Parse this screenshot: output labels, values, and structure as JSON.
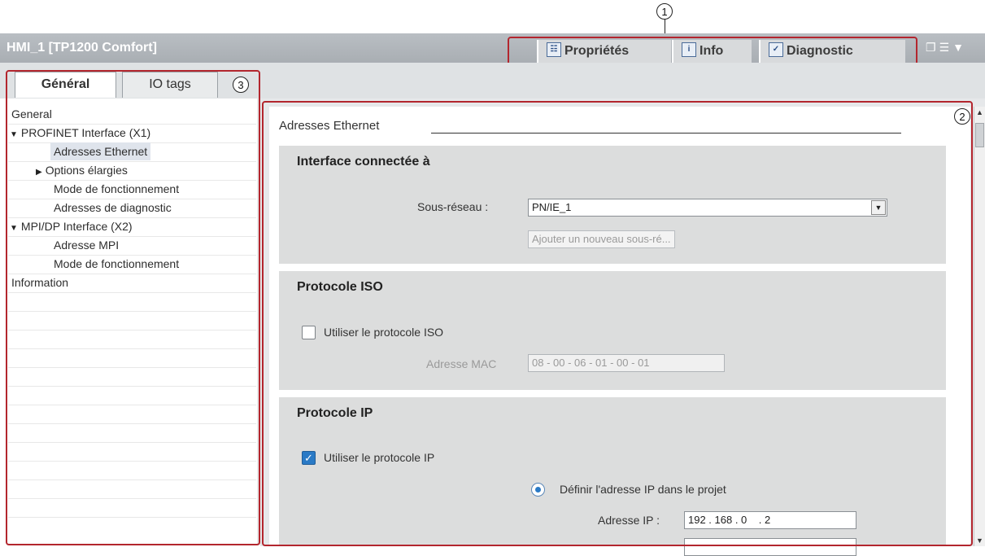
{
  "window": {
    "title": "HMI_1 [TP1200 Comfort]"
  },
  "top_tabs": [
    {
      "label": "Propriétés",
      "icon": "properties-icon"
    },
    {
      "label": "Info",
      "icon": "info-icon"
    },
    {
      "label": "Diagnostic",
      "icon": "diagnostic-icon"
    }
  ],
  "left_tabs": [
    {
      "label": "Général"
    },
    {
      "label": "IO tags"
    }
  ],
  "callouts": [
    "1",
    "2",
    "3"
  ],
  "nav": [
    {
      "label": "General"
    },
    {
      "label": "PROFINET Interface (X1)"
    },
    {
      "label": "Adresses Ethernet"
    },
    {
      "label": "Options élargies"
    },
    {
      "label": "Mode de fonctionnement"
    },
    {
      "label": "Adresses de diagnostic"
    },
    {
      "label": "MPI/DP Interface (X2)"
    },
    {
      "label": "Adresse MPI"
    },
    {
      "label": "Mode de fonctionnement"
    },
    {
      "label": "Information"
    }
  ],
  "content": {
    "heading": "Adresses Ethernet",
    "interface": {
      "title": "Interface connectée à",
      "subnet_label": "Sous-réseau :",
      "subnet_value": "PN/IE_1",
      "add_subnet_button": "Ajouter un nouveau sous-ré..."
    },
    "iso": {
      "title": "Protocole ISO",
      "use_iso_label": "Utiliser le protocole ISO",
      "use_iso_checked": false,
      "mac_label": "Adresse MAC",
      "mac_value": "08 - 00 - 06 - 01 - 00 - 01"
    },
    "ip": {
      "title": "Protocole IP",
      "use_ip_label": "Utiliser le protocole IP",
      "use_ip_checked": true,
      "define_in_project_label": "Définir l'adresse IP dans le projet",
      "ip_label": "Adresse IP :",
      "ip_value": "192 . 168 . 0    . 2"
    }
  }
}
